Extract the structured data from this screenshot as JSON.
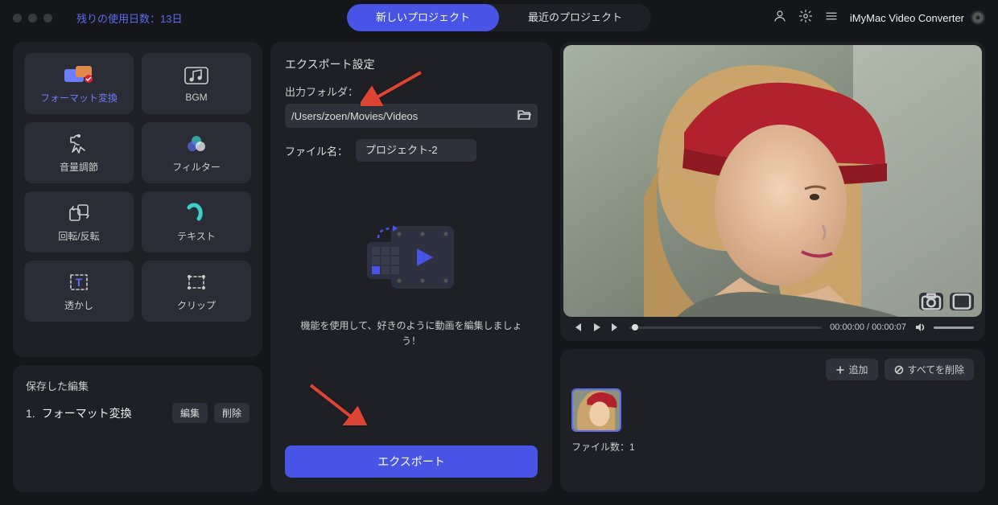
{
  "header": {
    "trial_text": "残りの使用日数：13日",
    "tab_new": "新しいプロジェクト",
    "tab_recent": "最近のプロジェクト",
    "app_name": "iMyMac Video Converter"
  },
  "tools": [
    {
      "label": "フォーマット変換",
      "selected": true
    },
    {
      "label": "BGM",
      "selected": false
    },
    {
      "label": "音量調節",
      "selected": false
    },
    {
      "label": "フィルター",
      "selected": false
    },
    {
      "label": "回転/反転",
      "selected": false
    },
    {
      "label": "テキスト",
      "selected": false
    },
    {
      "label": "透かし",
      "selected": false
    },
    {
      "label": "クリップ",
      "selected": false
    }
  ],
  "saved_edits": {
    "header": "保存した編集",
    "items": [
      {
        "index": "1.",
        "label": "フォーマット変換"
      }
    ],
    "edit_btn": "編集",
    "delete_btn": "削除"
  },
  "export": {
    "title": "エクスポート設定",
    "output_folder_label": "出力フォルダ：",
    "output_folder_value": "/Users/zoen/Movies/Videos",
    "filename_label": "ファイル名：",
    "filename_value": "プロジェクト-2",
    "hint": "機能を使用して、好きのように動画を編集しましょう！",
    "export_btn": "エクスポート"
  },
  "player": {
    "time_current": "00:00:00",
    "time_total": "00:00:07"
  },
  "files": {
    "add_btn": "追加",
    "delete_all_btn": "すべてを削除",
    "count_label": "ファイル数：1"
  }
}
